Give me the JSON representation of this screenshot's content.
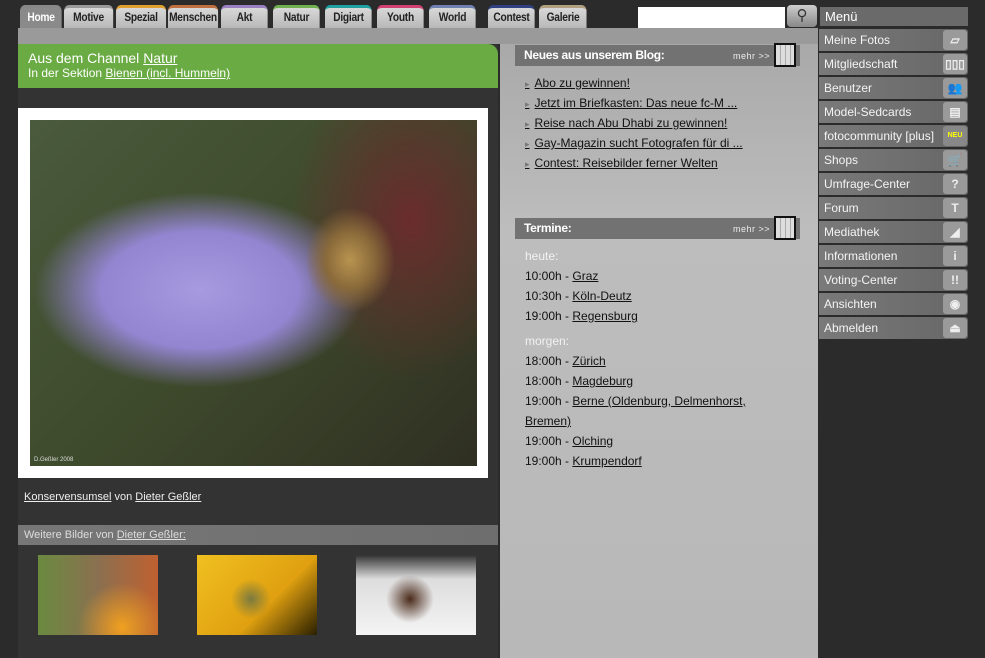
{
  "tabs": [
    {
      "label": "Home",
      "color": "#888888",
      "active": true
    },
    {
      "label": "Motive",
      "color": "#9a9a9a"
    },
    {
      "label": "Spezial",
      "color": "#e0a030"
    },
    {
      "label": "Menschen",
      "color": "#c07040"
    },
    {
      "label": "Akt",
      "color": "#9a80c0"
    },
    {
      "label": "Natur",
      "color": "#70b050"
    },
    {
      "label": "Digiart",
      "color": "#20a0a0"
    },
    {
      "label": "Youth",
      "color": "#d04070"
    },
    {
      "label": "World",
      "color": "#7080b0"
    },
    {
      "label": "Contest",
      "color": "#304080"
    },
    {
      "label": "Galerie",
      "color": "#b0a080"
    }
  ],
  "search": {
    "value": "",
    "icon": "magnifier-icon"
  },
  "channel": {
    "prefix": "Aus dem Channel ",
    "name": "Natur",
    "section_prefix": "In der Sektion ",
    "section": "Bienen (incl. Hummeln)"
  },
  "photo": {
    "title": "Konservensumsel",
    "by": " von ",
    "author": "Dieter Geßler",
    "signature": "D.Geßler 2008"
  },
  "more_images": {
    "prefix": "Weitere Bilder von ",
    "author": "Dieter Geßler:"
  },
  "blog": {
    "title": "Neues aus unserem Blog:",
    "more": "mehr >>",
    "items": [
      "Abo zu gewinnen!",
      "Jetzt im Briefkasten: Das neue fc-M ...",
      "Reise nach Abu Dhabi zu gewinnen!",
      "Gay-Magazin sucht Fotografen für di ...",
      "Contest: Reisebilder ferner Welten"
    ]
  },
  "termine": {
    "title": "Termine:",
    "more": "mehr >>",
    "today_label": "heute:",
    "today": [
      {
        "time": "10:00h - ",
        "place": "Graz"
      },
      {
        "time": "10:30h - ",
        "place": "Köln-Deutz"
      },
      {
        "time": "19:00h - ",
        "place": "Regensburg"
      }
    ],
    "tomorrow_label": "morgen:",
    "tomorrow": [
      {
        "time": "18:00h - ",
        "place": "Zürich"
      },
      {
        "time": "18:00h - ",
        "place": "Magdeburg"
      },
      {
        "time": "19:00h - ",
        "place": "Berne (Oldenburg, Delmenhorst, Bremen)"
      },
      {
        "time": "19:00h - ",
        "place": "Olching"
      },
      {
        "time": "19:00h - ",
        "place": "Krumpendorf"
      }
    ]
  },
  "menu": {
    "title": "Menü",
    "items": [
      {
        "label": "Meine Fotos",
        "icon": "photos-icon",
        "glyph": "▱"
      },
      {
        "label": "Mitgliedschaft",
        "icon": "membership-icon",
        "glyph": "▯▯▯"
      },
      {
        "label": "Benutzer",
        "icon": "users-icon",
        "glyph": "👥"
      },
      {
        "label": "Model-Sedcards",
        "icon": "sedcard-icon",
        "glyph": "▤"
      },
      {
        "label": "fotocommunity [plus]",
        "icon": "new-badge-icon",
        "glyph": "NEU"
      },
      {
        "label": "Shops",
        "icon": "cart-icon",
        "glyph": "🛒"
      },
      {
        "label": "Umfrage-Center",
        "icon": "question-icon",
        "glyph": "?"
      },
      {
        "label": "Forum",
        "icon": "text-icon",
        "glyph": "T"
      },
      {
        "label": "Mediathek",
        "icon": "rss-film-icon",
        "glyph": "◢"
      },
      {
        "label": "Informationen",
        "icon": "info-icon",
        "glyph": "i"
      },
      {
        "label": "Voting-Center",
        "icon": "exclamation-icon",
        "glyph": "!!"
      },
      {
        "label": "Ansichten",
        "icon": "eye-icon",
        "glyph": "◉"
      },
      {
        "label": "Abmelden",
        "icon": "eject-icon",
        "glyph": "⏏"
      }
    ]
  }
}
